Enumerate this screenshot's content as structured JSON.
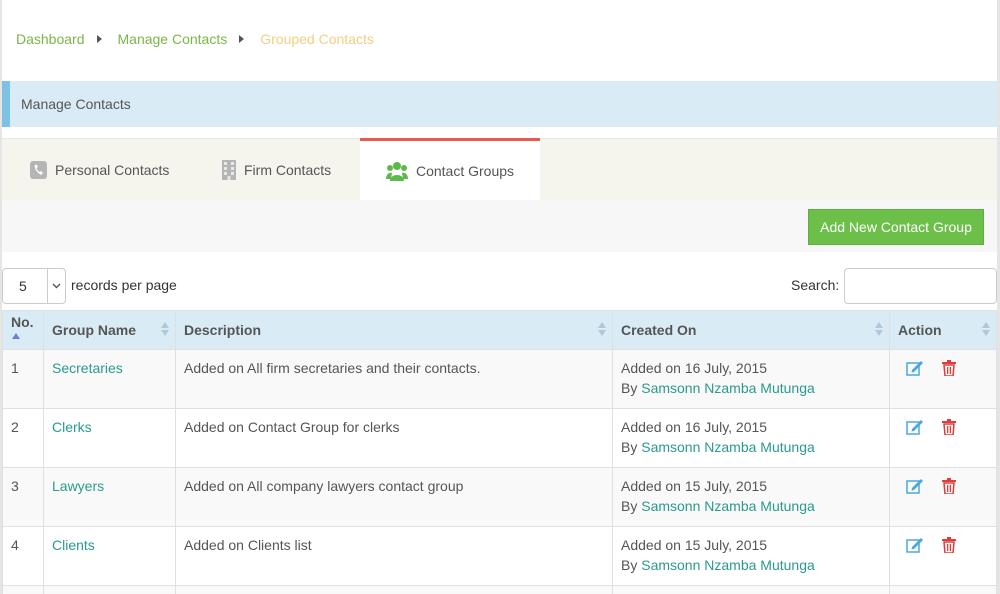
{
  "breadcrumb": {
    "items": [
      "Dashboard",
      "Manage Contacts"
    ],
    "current": "Grouped Contacts"
  },
  "panel": {
    "title": "Manage Contacts"
  },
  "tabs": [
    {
      "label": "Personal Contacts",
      "icon": "phone-icon"
    },
    {
      "label": "Firm Contacts",
      "icon": "building-icon"
    },
    {
      "label": "Contact Groups",
      "icon": "users-icon",
      "active": true
    }
  ],
  "toolbar": {
    "add_label": "Add New Contact Group"
  },
  "table_controls": {
    "length_value": "5",
    "length_label": "records per page",
    "search_label": "Search:",
    "search_value": ""
  },
  "table": {
    "columns": [
      "No.",
      "Group Name",
      "Description",
      "Created On",
      "Action"
    ],
    "rows": [
      {
        "no": "1",
        "name": "Secretaries",
        "description": "Added on All firm secretaries and their contacts.",
        "created": "Added on 16 July, 2015",
        "by_prefix": "By",
        "by": "Samsonn Nzamba Mutunga"
      },
      {
        "no": "2",
        "name": "Clerks",
        "description": "Added on Contact Group for clerks",
        "created": "Added on 16 July, 2015",
        "by_prefix": "By",
        "by": "Samsonn Nzamba Mutunga"
      },
      {
        "no": "3",
        "name": "Lawyers",
        "description": "Added on All company lawyers contact group",
        "created": "Added on 15 July, 2015",
        "by_prefix": "By",
        "by": "Samsonn Nzamba Mutunga"
      },
      {
        "no": "4",
        "name": "Clients",
        "description": "Added on Clients list",
        "created": "Added on 15 July, 2015",
        "by_prefix": "By",
        "by": "Samsonn Nzamba Mutunga"
      }
    ]
  },
  "colors": {
    "link_green": "#7ab648",
    "breadcrumb_current": "#f0d080",
    "header_blue": "#d9ecf5",
    "accent_blue": "#7cc2e4",
    "active_tab_border": "#e8594f",
    "add_button": "#6cc04a",
    "table_link": "#2a9a8e",
    "edit_icon": "#4aa8e0",
    "delete_icon": "#e03c3c"
  }
}
